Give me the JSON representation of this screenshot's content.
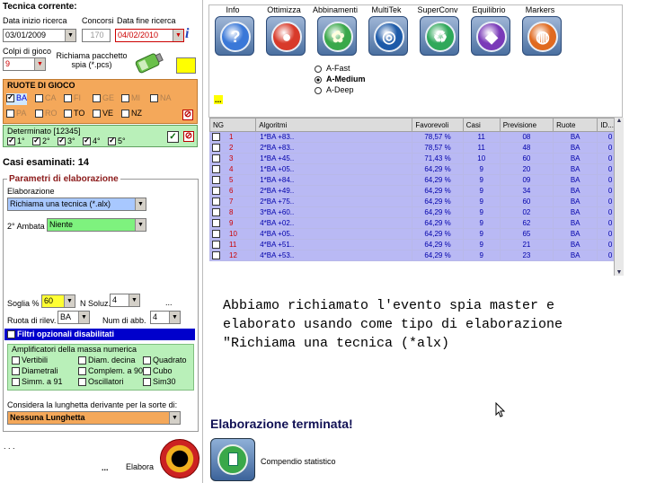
{
  "left": {
    "title": "Tecnica corrente:",
    "data_inizio_label": "Data inizio ricerca",
    "data_inizio": "03/01/2009",
    "concorsi_label": "Concorsi",
    "concorsi": "170",
    "data_fine_label": "Data fine ricerca",
    "data_fine": "04/02/2010",
    "colpi_label": "Colpi di gioco",
    "colpi": "9",
    "richiama_label": "Richiama pacchetto spia (*.pcs)",
    "ruote_header": "RUOTE DI GIOCO",
    "ruote": [
      {
        "name": "BA",
        "checked": true
      },
      {
        "name": "CA",
        "checked": false
      },
      {
        "name": "FI",
        "checked": false
      },
      {
        "name": "GE",
        "checked": false
      },
      {
        "name": "MI",
        "checked": false
      },
      {
        "name": "NA",
        "checked": false
      },
      {
        "name": "PA",
        "checked": false
      },
      {
        "name": "RO",
        "checked": false
      },
      {
        "name": "TO",
        "checked": false
      },
      {
        "name": "VE",
        "checked": false
      },
      {
        "name": "NZ",
        "checked": false
      }
    ],
    "determinato_label": "Determinato [12345]",
    "determinato": [
      "1°",
      "2°",
      "3°",
      "4°",
      "5°"
    ],
    "casi_esaminati": "Casi esaminati: 14",
    "parametri_title": "Parametri di elaborazione",
    "elaborazione_label": "Elaborazione",
    "elaborazione_value": "Richiama una tecnica (*.alx)",
    "ambata_label": "2° Ambata",
    "ambata_value": "Niente",
    "soglia_label": "Soglia %",
    "soglia_value": "60",
    "nsoluz_label": "N Soluz.",
    "nsoluz_value": "4",
    "dots": "...",
    "ruota_rilev_label": "Ruota di rilev.",
    "ruota_rilev_value": "BA",
    "num_abb_label": "Num di abb.",
    "num_abb_value": "4",
    "filtri_label": "Filtri opzionali disabilitati",
    "ampl_title": "Amplificatori della massa numerica",
    "ampl_items": [
      "Vertibili",
      "Diam. decina",
      "Quadrato",
      "Diametrali",
      "Complem. a 90",
      "Cubo",
      "Simm. a 91",
      "Oscillatori",
      "Sim30"
    ],
    "considera_label": "Considera la lunghetta derivante per la sorte di:",
    "lunghetta_value": "Nessuna Lunghetta",
    "bottom_dots": ". . .",
    "elabora_dots": "...",
    "elabora_label": "Elabora"
  },
  "toolbar": {
    "buttons": [
      "Info",
      "Ottimizza",
      "Abbinamenti",
      "MultiTek",
      "SuperConv",
      "Equilibrio",
      "Markers"
    ],
    "mode_options": [
      "A-Fast",
      "A-Medium",
      "A-Deep"
    ],
    "mode_selected": "A-Medium",
    "dots": "..."
  },
  "table": {
    "headers": [
      "NG",
      "Algoritmi",
      "Favorevoli",
      "Casi",
      "Previsione",
      "Ruote",
      "ID..."
    ],
    "rows": [
      [
        "1",
        "1*BA +83..",
        "78,57 %",
        "11",
        "08",
        "BA",
        "0"
      ],
      [
        "2",
        "2*BA +83..",
        "78,57 %",
        "11",
        "48",
        "BA",
        "0"
      ],
      [
        "3",
        "1*BA +45..",
        "71,43 %",
        "10",
        "60",
        "BA",
        "0"
      ],
      [
        "4",
        "1*BA +05..",
        "64,29 %",
        "9",
        "20",
        "BA",
        "0"
      ],
      [
        "5",
        "1*BA +84..",
        "64,29 %",
        "9",
        "09",
        "BA",
        "0"
      ],
      [
        "6",
        "2*BA +49..",
        "64,29 %",
        "9",
        "34",
        "BA",
        "0"
      ],
      [
        "7",
        "2*BA +75..",
        "64,29 %",
        "9",
        "60",
        "BA",
        "0"
      ],
      [
        "8",
        "3*BA +60..",
        "64,29 %",
        "9",
        "02",
        "BA",
        "0"
      ],
      [
        "9",
        "4*BA +02..",
        "64,29 %",
        "9",
        "62",
        "BA",
        "0"
      ],
      [
        "10",
        "4*BA +05..",
        "64,29 %",
        "9",
        "65",
        "BA",
        "0"
      ],
      [
        "11",
        "4*BA +51..",
        "64,29 %",
        "9",
        "21",
        "BA",
        "0"
      ],
      [
        "12",
        "4*BA +53..",
        "64,29 %",
        "9",
        "23",
        "BA",
        "0"
      ]
    ]
  },
  "annotation": "Abbiamo richiamato l'evento spia master e elaborato usando come tipo di elaborazione \"Richiama una tecnica (*alx)",
  "status": "Elaborazione terminata!",
  "compendio_label": "Compendio statistico",
  "colors": {
    "accent_red": "#cc0000",
    "row_bg": "#b9b9f4",
    "ruote_bg": "#f4a85a",
    "determinato_bg": "#b9f0b9",
    "filtri_bar": "#0000cc"
  }
}
